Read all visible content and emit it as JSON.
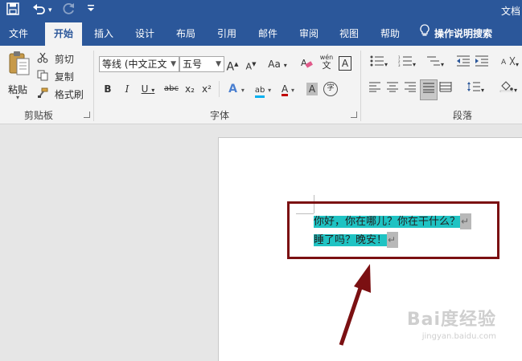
{
  "titlebar": {
    "title": "文档",
    "save_icon": "save-icon",
    "undo_icon": "undo-icon",
    "redo_icon": "redo-icon",
    "customize_icon": "customize-qat-icon"
  },
  "tabs": [
    "文件",
    "开始",
    "插入",
    "设计",
    "布局",
    "引用",
    "邮件",
    "审阅",
    "视图",
    "帮助"
  ],
  "tell_me": "操作说明搜索",
  "clipboard": {
    "paste": "粘贴",
    "cut": "剪切",
    "copy": "复制",
    "format_painter": "格式刷",
    "group_label": "剪贴板"
  },
  "font": {
    "font_name": "等线 (中文正文",
    "font_size": "五号",
    "grow": "A",
    "shrink": "A",
    "case": "Aa",
    "pinyin_top": "wén",
    "pinyin_bottom": "文",
    "border_char": "A",
    "bold": "B",
    "italic": "I",
    "underline": "U",
    "strike": "abc",
    "subscript": "x₂",
    "superscript": "x²",
    "effects": "A",
    "highlight": "ab",
    "font_color": "A",
    "shading": "A",
    "enclose": "字",
    "group_label": "字体"
  },
  "paragraph": {
    "group_label": "段落"
  },
  "document": {
    "line1": "你好，你在哪儿？你在干什么？",
    "line2": "睡了吗？晚安！",
    "pilcrow": "↵"
  },
  "watermark": {
    "brand": "Bai度经验",
    "url": "jingyan.baidu.com"
  },
  "colors": {
    "title_bar": "#2b579a",
    "ribbon": "#f3f3f3",
    "highlight": "#1fc3c3",
    "annotation": "#7b1012",
    "highlight_underline": "#00b0f0",
    "font_color_bar": "#c00000"
  }
}
